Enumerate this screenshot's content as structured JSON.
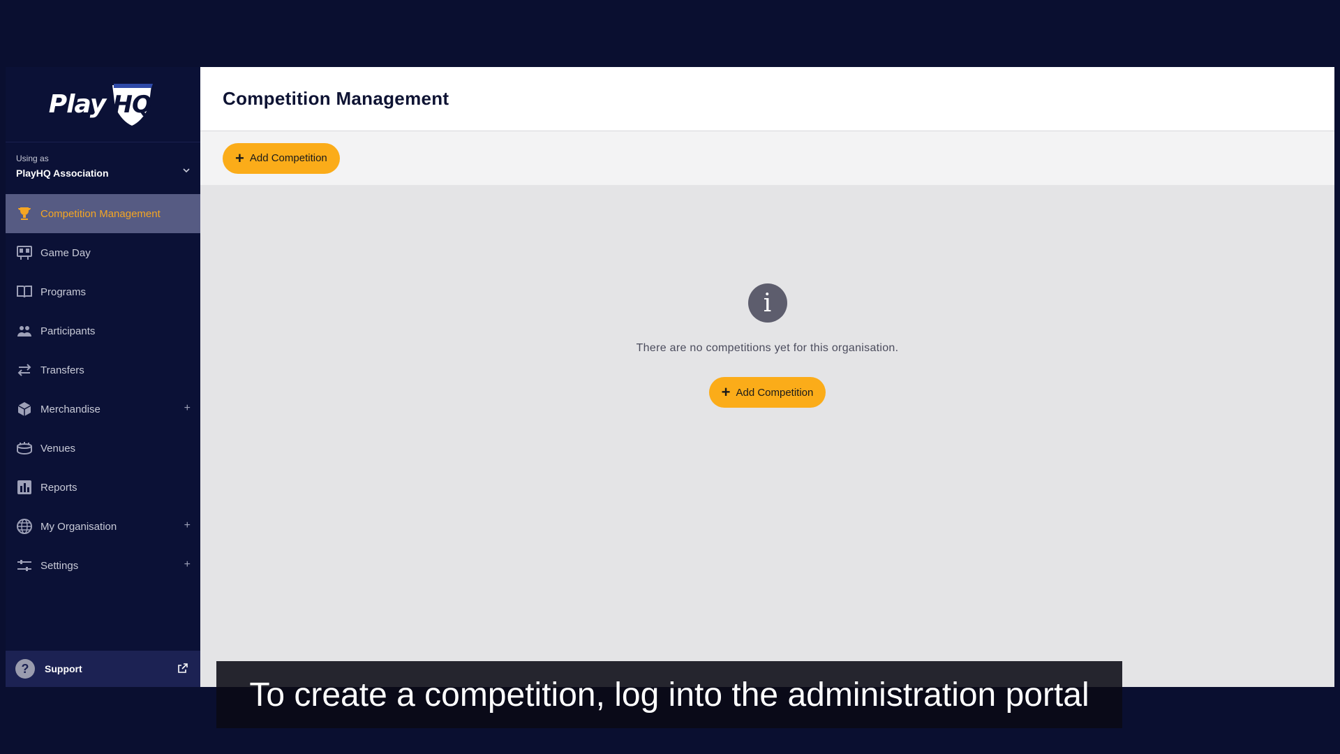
{
  "brand": {
    "logo_text": "Play",
    "logo_mark": "HQ"
  },
  "account": {
    "using_as_label": "Using as",
    "organisation": "PlayHQ Association"
  },
  "nav": [
    {
      "id": "competition-management",
      "label": "Competition Management",
      "icon": "trophy-icon",
      "active": true,
      "expandable": false
    },
    {
      "id": "game-day",
      "label": "Game Day",
      "icon": "scoreboard-icon",
      "active": false,
      "expandable": false
    },
    {
      "id": "programs",
      "label": "Programs",
      "icon": "book-icon",
      "active": false,
      "expandable": false
    },
    {
      "id": "participants",
      "label": "Participants",
      "icon": "people-icon",
      "active": false,
      "expandable": false
    },
    {
      "id": "transfers",
      "label": "Transfers",
      "icon": "transfer-arrows-icon",
      "active": false,
      "expandable": false
    },
    {
      "id": "merchandise",
      "label": "Merchandise",
      "icon": "box-icon",
      "active": false,
      "expandable": true
    },
    {
      "id": "venues",
      "label": "Venues",
      "icon": "stadium-icon",
      "active": false,
      "expandable": false
    },
    {
      "id": "reports",
      "label": "Reports",
      "icon": "bar-chart-icon",
      "active": false,
      "expandable": false
    },
    {
      "id": "my-organisation",
      "label": "My Organisation",
      "icon": "globe-icon",
      "active": false,
      "expandable": true
    },
    {
      "id": "settings",
      "label": "Settings",
      "icon": "sliders-icon",
      "active": false,
      "expandable": true
    }
  ],
  "support": {
    "label": "Support",
    "icon_glyph": "?"
  },
  "page": {
    "title": "Competition Management",
    "add_button_label": "Add Competition",
    "empty_message": "There are no competitions yet for this organisation.",
    "empty_button_label": "Add Competition",
    "info_glyph": "i"
  },
  "caption": "To create a competition, log into the administration portal",
  "colors": {
    "accent": "#fbac19",
    "sidebar": "#0b1136",
    "active_nav": "#565b83"
  }
}
